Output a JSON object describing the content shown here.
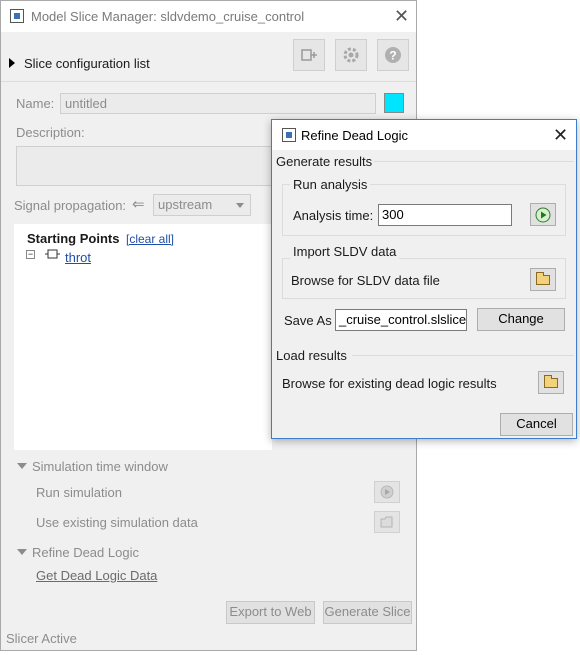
{
  "main_window": {
    "title": "Model Slice Manager: sldvdemo_cruise_control",
    "slice_config_label": "Slice configuration list",
    "name_label": "Name:",
    "name_value": "untitled",
    "name_color": "#00e5ff",
    "description_label": "Description:",
    "signal_propagation_label": "Signal propagation:",
    "propagation_value": "upstream",
    "starting_points_label": "Starting Points",
    "clear_all_link": "[clear all]",
    "tree_item": "throt",
    "simulation_section": "Simulation time window",
    "run_simulation": "Run simulation",
    "use_existing": "Use existing simulation data",
    "refine_section": "Refine Dead Logic",
    "get_dead_logic": "Get Dead Logic Data",
    "export_button": "Export to Web",
    "generate_button": "Generate Slice",
    "status": "Slicer Active"
  },
  "dialog": {
    "title": "Refine Dead Logic",
    "generate_results": "Generate results",
    "run_analysis": "Run analysis",
    "analysis_time_label": "Analysis time:",
    "analysis_time_value": "300",
    "import_sldv": "Import SLDV data",
    "browse_sldv": "Browse for SLDV data file",
    "save_as_label": "Save As",
    "save_as_value": "_cruise_control.slslicex",
    "change_button": "Change",
    "load_results": "Load results",
    "browse_existing": "Browse for existing dead logic results",
    "cancel_button": "Cancel"
  },
  "icons": {
    "toolbar": [
      "add-config-icon",
      "gear-icon",
      "help-icon"
    ],
    "run": "play-icon",
    "folder": "folder-icon"
  }
}
